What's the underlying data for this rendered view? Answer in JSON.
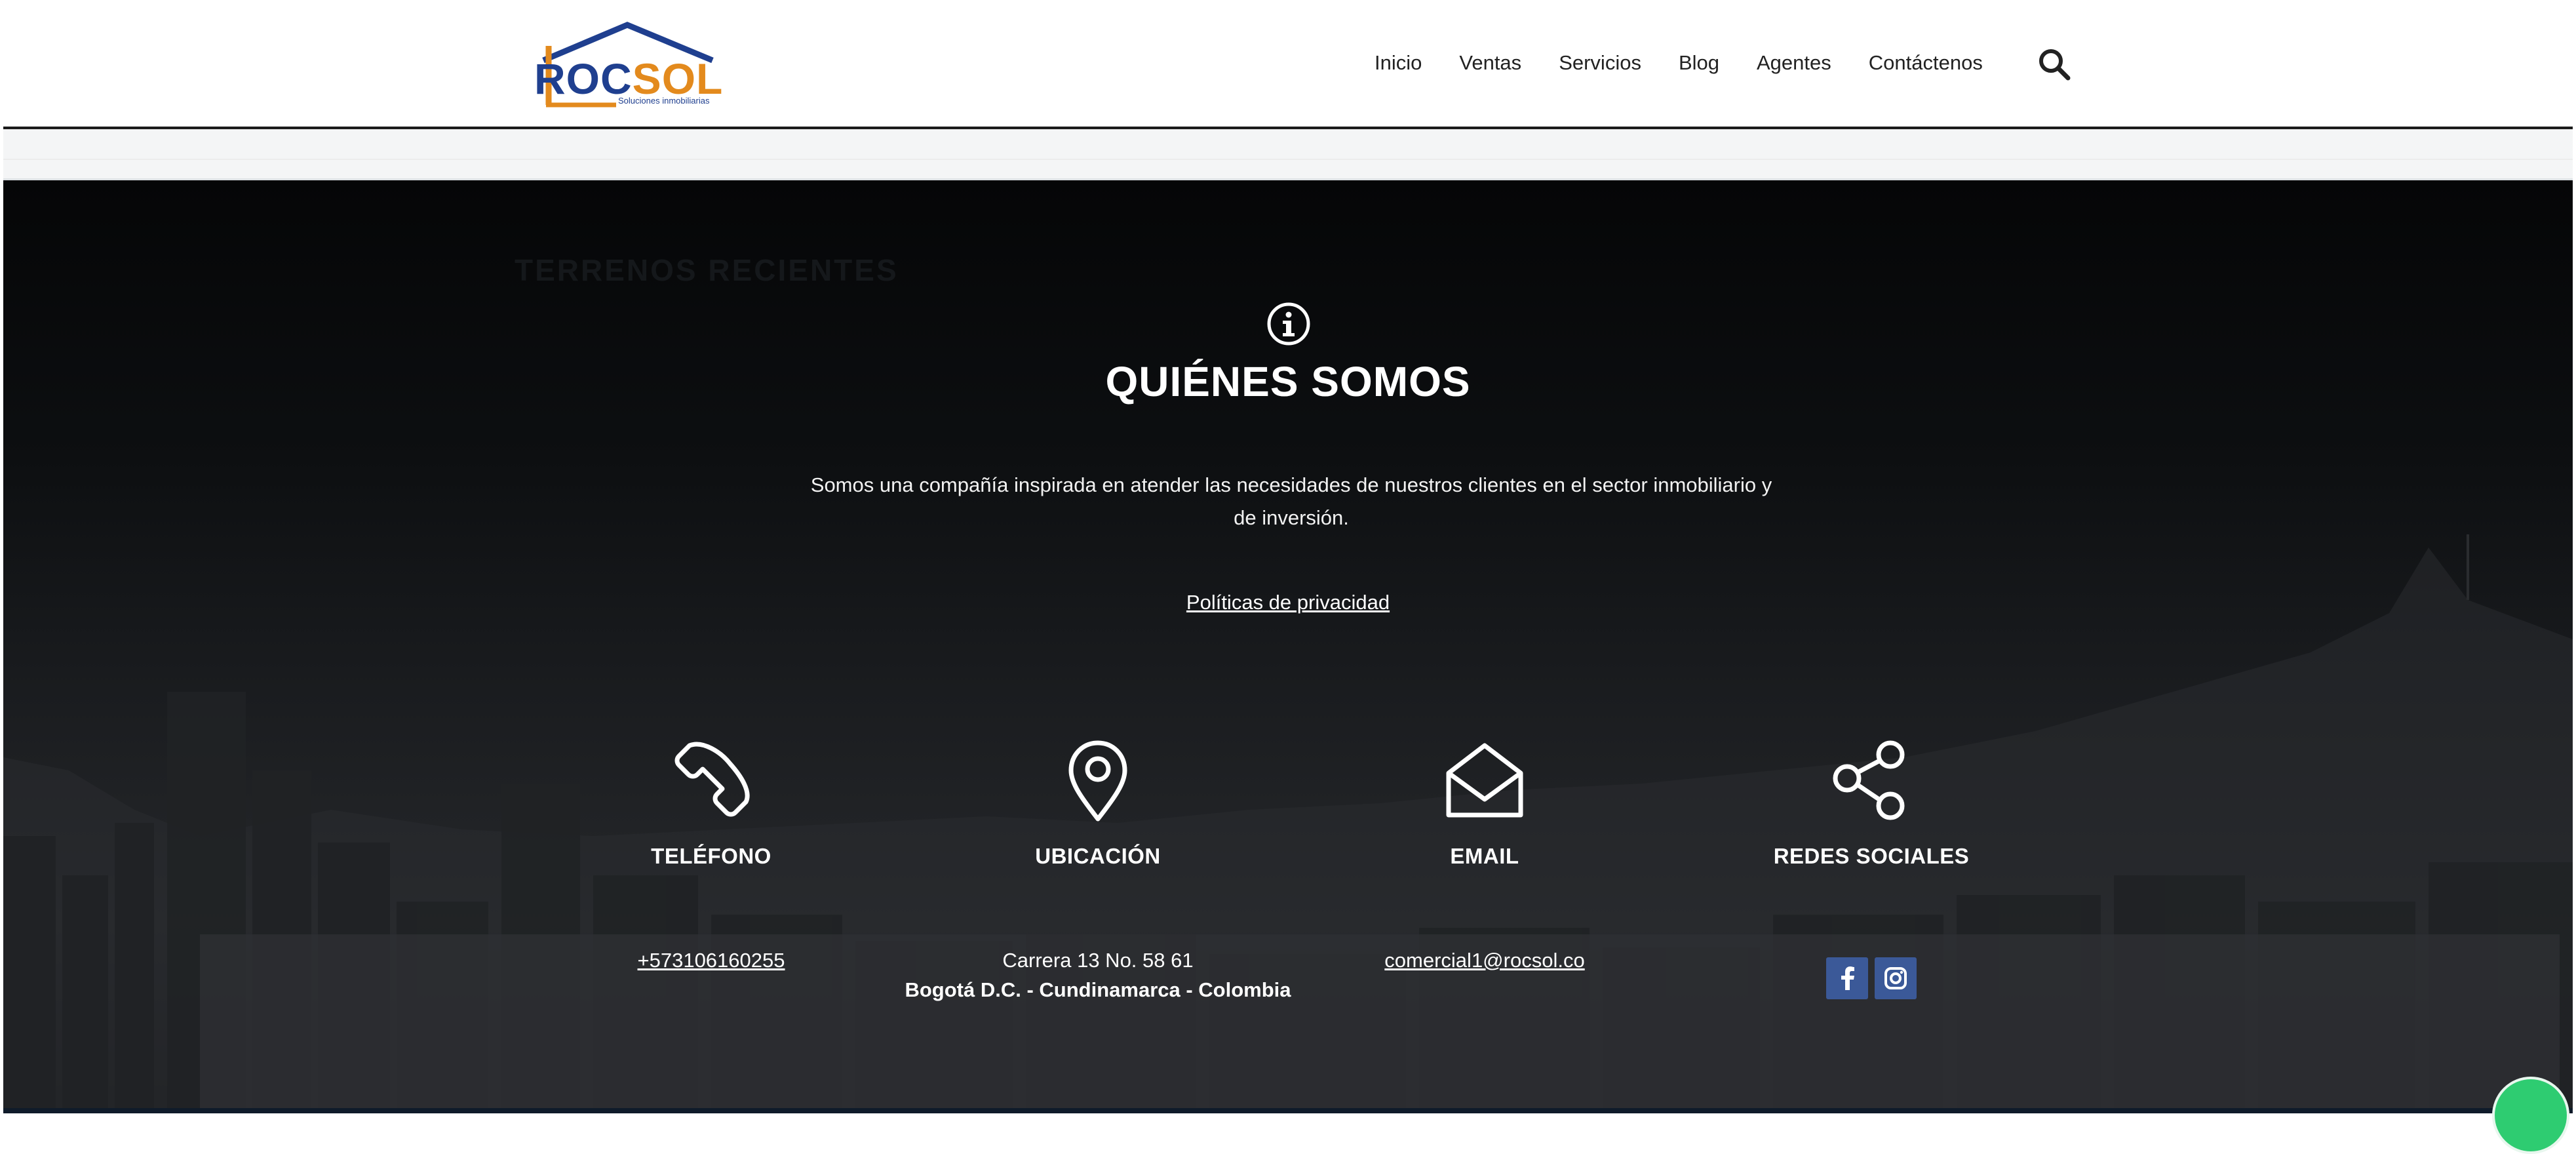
{
  "brand": {
    "logo_word_a": "ROC",
    "logo_word_b": "SOL",
    "tagline": "Soluciones inmobiliarias",
    "primary_color": "#1f3f8f",
    "accent_color": "#e38a1d"
  },
  "nav": {
    "items": [
      {
        "label": "Inicio"
      },
      {
        "label": "Ventas"
      },
      {
        "label": "Servicios"
      },
      {
        "label": "Blog"
      },
      {
        "label": "Agentes"
      },
      {
        "label": "Contáctenos"
      }
    ],
    "search_icon": "search-icon"
  },
  "footer": {
    "ghost_heading": "TERRENOS RECIENTES",
    "about": {
      "icon": "info-circle-icon",
      "title": "QUIÉNES SOMOS",
      "text": "Somos una compañía inspirada en atender las necesidades de nuestros clientes en el sector inmobiliario y de inversión.",
      "privacy_link": "Políticas de privacidad"
    },
    "contact": {
      "phone": {
        "icon": "phone-icon",
        "title": "TELÉFONO",
        "value": "+573106160255"
      },
      "location": {
        "icon": "map-pin-icon",
        "title": "UBICACIÓN",
        "address_line1": "Carrera 13 No. 58 61",
        "address_line2": "Bogotá D.C. - Cundinamarca - Colombia"
      },
      "email": {
        "icon": "envelope-open-icon",
        "title": "EMAIL",
        "value": "comercial1@rocsol.co"
      },
      "social": {
        "icon": "share-icon",
        "title": "REDES SOCIALES",
        "networks": [
          "facebook-icon",
          "instagram-icon"
        ],
        "button_color": "#3b5998"
      }
    }
  }
}
